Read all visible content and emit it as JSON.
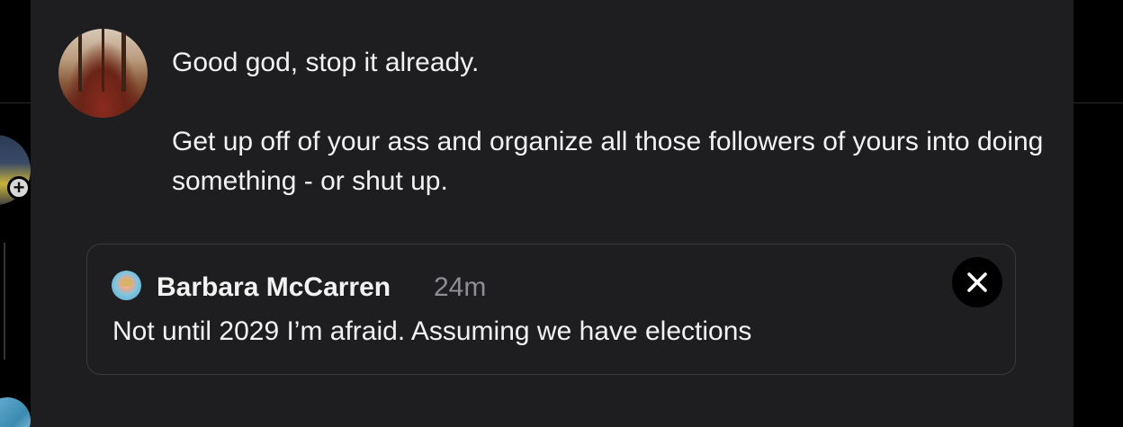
{
  "post": {
    "paragraphs": [
      "Good god, stop it already.",
      "Get up off of your ass and organize all those followers of yours into doing something - or shut up."
    ]
  },
  "quote": {
    "author_name": "Barbara McCarren",
    "time_ago": "24m",
    "body": "Not until 2029 I’m afraid. Assuming we have elections"
  },
  "icons": {
    "close": "close-icon",
    "add": "plus-icon"
  },
  "colors": {
    "sheet_bg": "#1e1e20",
    "text": "#f2f2f2",
    "muted": "#8e8e93",
    "border": "#3a3a3c"
  }
}
